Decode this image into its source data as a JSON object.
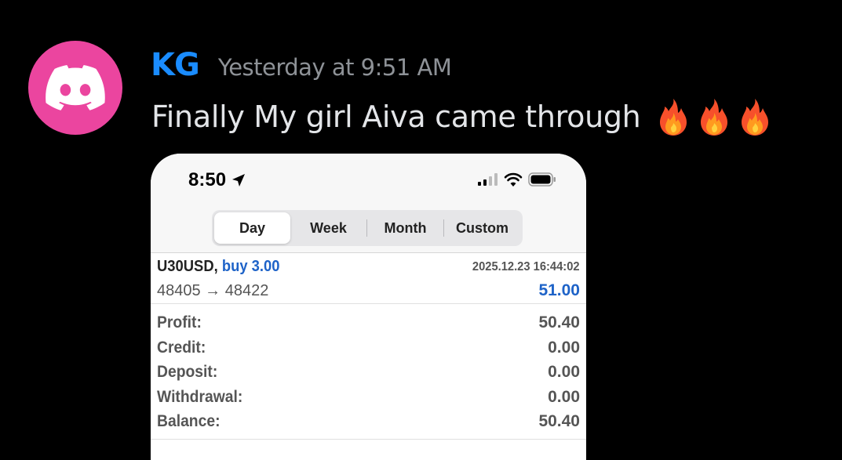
{
  "message": {
    "author": "KG",
    "timestamp": "Yesterday at 9:51 AM",
    "text": "Finally My girl Aiva came through",
    "emoji": [
      "fire-emoji",
      "fire-emoji",
      "fire-emoji"
    ],
    "avatar_icon": "discord-logo-icon",
    "colors": {
      "avatar_bg": "#eb459f",
      "author": "#1a8cff",
      "timestamp": "#8e9297",
      "text": "#e3e5e8",
      "background": "#000000"
    }
  },
  "attachment": {
    "status_bar": {
      "time": "8:50",
      "icons": [
        "location-arrow-icon",
        "signal-icon",
        "wifi-icon",
        "battery-icon"
      ]
    },
    "tabs": [
      {
        "label": "Day",
        "active": true
      },
      {
        "label": "Week",
        "active": false
      },
      {
        "label": "Month",
        "active": false
      },
      {
        "label": "Custom",
        "active": false
      }
    ],
    "deal": {
      "symbol": "U30USD,",
      "action": "buy 3.00",
      "datetime": "2025.12.23 16:44:02",
      "prices": "48405 → 48422",
      "profit": "51.00"
    },
    "summary": [
      {
        "label": "Profit:",
        "value": "50.40"
      },
      {
        "label": "Credit:",
        "value": "0.00"
      },
      {
        "label": "Deposit:",
        "value": "0.00"
      },
      {
        "label": "Withdrawal:",
        "value": "0.00"
      },
      {
        "label": "Balance:",
        "value": "50.40"
      }
    ],
    "colors": {
      "accent_blue": "#1e63c8"
    }
  }
}
